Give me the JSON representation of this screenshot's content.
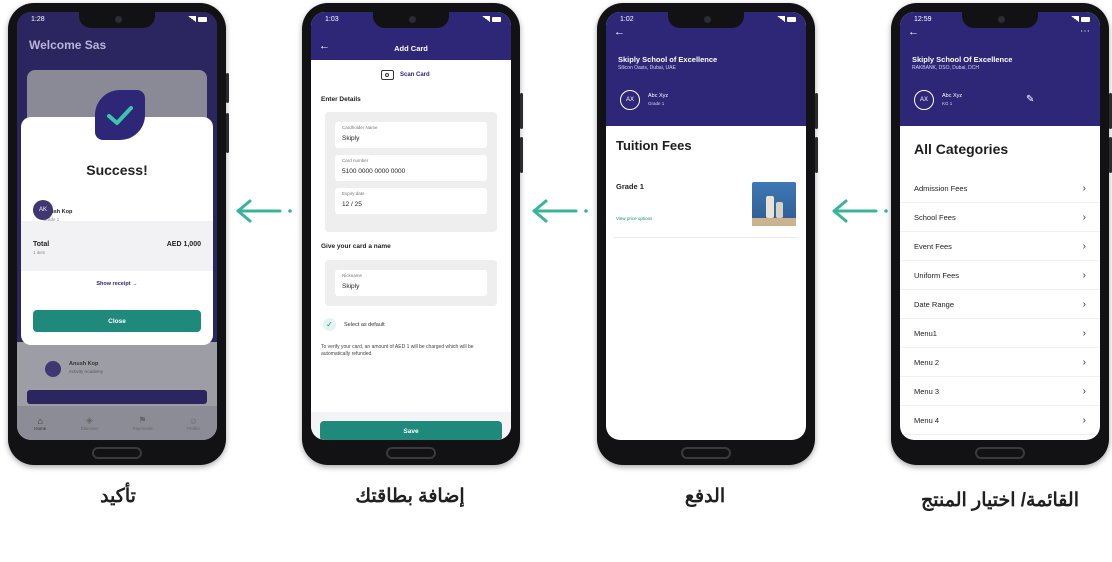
{
  "colors": {
    "purple": "#2e2777",
    "teal": "#1f8a7b",
    "arrow": "#39b39a"
  },
  "phone_categories": {
    "time": "12:59",
    "school": "Skiply School Of Excellence",
    "address": "RAKBANK, DSO, Dubai, DCH",
    "avatar": "AX",
    "student_name": "Abc Xyz",
    "student_grade": "KG 1",
    "title": "All Categories",
    "items": [
      "Admission Fees",
      "School Fees",
      "Event Fees",
      "Uniform Fees",
      "Date Range",
      "Menu1",
      "Menu 2",
      "Menu 3",
      "Menu 4"
    ]
  },
  "phone_payment": {
    "time": "1:02",
    "school": "Skiply School of Excellence",
    "address": "Silicon Oasis, Dubai, UAE",
    "avatar": "AX",
    "student_name": "Abc Xyz",
    "student_grade": "Grade 1",
    "title": "Tuition Fees",
    "grade": "Grade 1",
    "link": "View price options"
  },
  "phone_card": {
    "time": "1:03",
    "title": "Add Card",
    "scan": "Scan Card",
    "enter_details": "Enter Details",
    "cardholder_label": "Cardholder Name",
    "cardholder_value": "Skiply",
    "number_label": "Card number",
    "number_value": "5100 0000 0000 0000",
    "expiry_label": "Expiry date",
    "expiry_value": "12 / 25",
    "give_name": "Give your card a name",
    "nickname_label": "Nickname",
    "nickname_value": "Skiply",
    "default_label": "Select as default",
    "notice": "To verify your card, an amount of AED 1 will be charged which will be automatically refunded.",
    "save": "Save"
  },
  "phone_success": {
    "time": "1:28",
    "welcome": "Welcome Sas",
    "success": "Success!",
    "avatar": "AK",
    "name": "Anush Kop",
    "grade": "Grade 1",
    "total_label": "Total",
    "total_items": "1 item",
    "total_value": "AED 1,000",
    "receipt": "Show receipt",
    "close": "Close",
    "bg_name": "Anush Kop",
    "bg_sub": "Activity Academy",
    "nav": [
      "Home",
      "Discover",
      "Payments",
      "Profile"
    ]
  },
  "captions": {
    "list": "القائمة/ اختيار المنتج",
    "payment": "الدفع",
    "card": "إضافة بطاقتك",
    "confirm": "تأكيد"
  }
}
